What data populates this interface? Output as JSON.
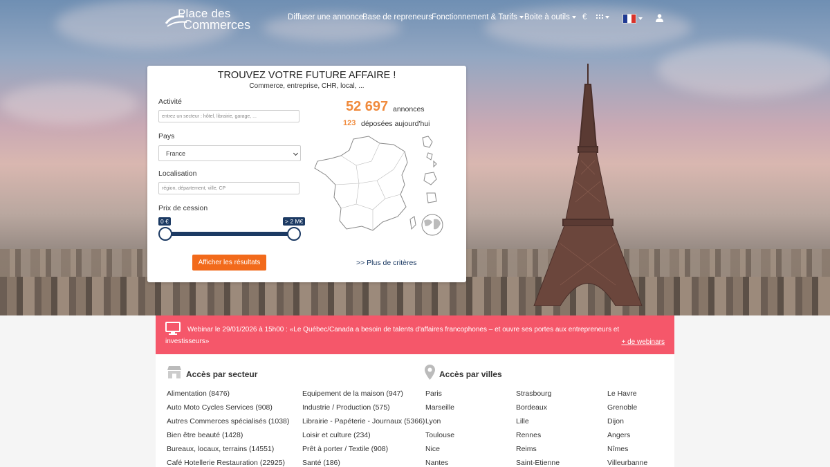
{
  "nav": {
    "logo_line1": "Place des",
    "logo_line2": "Commerces",
    "items": [
      {
        "label": "Diffuser une annonce"
      },
      {
        "label": "Base de repreneurs"
      },
      {
        "label": "Fonctionnement & Tarifs"
      },
      {
        "label": "Boite à outils"
      },
      {
        "label": "€"
      }
    ]
  },
  "search": {
    "title": "TROUVEZ VOTRE FUTURE AFFAIRE !",
    "subtitle": "Commerce, entreprise, CHR, local, ...",
    "activite_label": "Activité",
    "activite_placeholder": "entrez un secteur : hôtel, librairie, garage, ...",
    "pays_label": "Pays",
    "pays_value": "France",
    "localisation_label": "Localisation",
    "localisation_placeholder": "région, département, ville, CP",
    "prix_label": "Prix de cession",
    "prix_min": "0 €",
    "prix_max": "> 2 M€",
    "submit_label": "Afficher les résultats",
    "more_criteria": ">> Plus de critères",
    "count_total": "52 697",
    "count_total_label": "annonces",
    "count_today": "123",
    "count_today_label": "déposées aujourd'hui"
  },
  "webinar": {
    "text": "Webinar le 29/01/2026 à 15h00 :  «Le Québec/Canada a besoin de talents d'affaires francophones – et ouvre ses portes aux entrepreneurs et investisseurs»",
    "more": "+ de webinars"
  },
  "access": {
    "sector_title": "Accès par secteur",
    "city_title": "Accès par villes",
    "sectors_col1": [
      "Alimentation (8476)",
      "Auto Moto Cycles Services (908)",
      "Autres Commerces spécialisés (1038)",
      "Bien être beauté (1428)",
      "Bureaux, locaux, terrains (14551)",
      "Café Hotellerie Restauration (22925)"
    ],
    "sectors_col2": [
      "Equipement de la maison (947)",
      "Industrie / Production (575)",
      "Librairie - Papéterie - Journaux (5366)",
      "Loisir et culture (234)",
      "Prêt à porter / Textile (908)",
      "Santé (186)"
    ],
    "cities_col1": [
      "Paris",
      "Marseille",
      "Lyon",
      "Toulouse",
      "Nice",
      "Nantes"
    ],
    "cities_col2": [
      "Strasbourg",
      "Bordeaux",
      "Lille",
      "Rennes",
      "Reims",
      "Saint-Etienne"
    ],
    "cities_col3": [
      "Le Havre",
      "Grenoble",
      "Dijon",
      "Angers",
      "Nîmes",
      "Villeurbanne"
    ]
  }
}
